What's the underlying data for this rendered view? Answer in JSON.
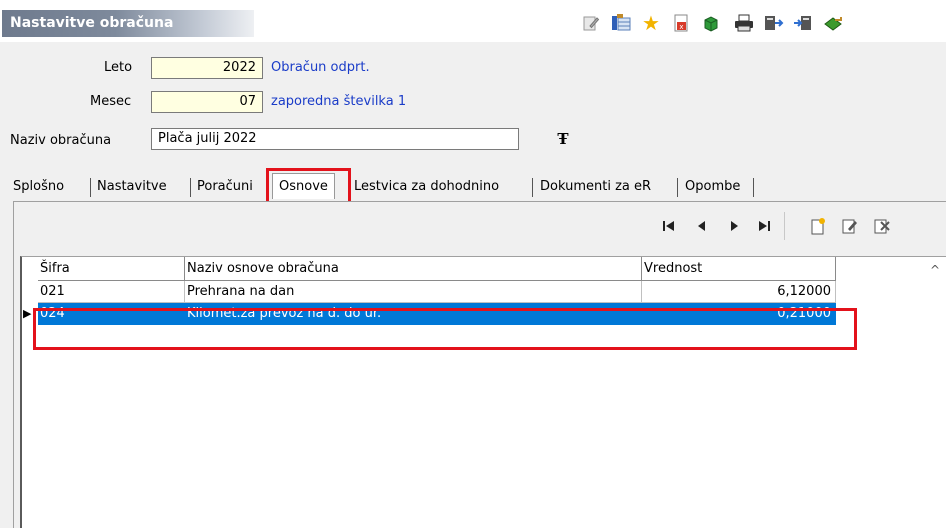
{
  "window": {
    "title": "Nastavitve obračuna"
  },
  "toolbar_icons": [
    "edit-icon",
    "table-icon",
    "star-icon",
    "pdf-icon",
    "cube-icon",
    "printer-icon",
    "export-icon",
    "import-icon",
    "exit-icon"
  ],
  "form": {
    "leto_label": "Leto",
    "leto_value": "2022",
    "leto_status": "Obračun odprt.",
    "mesec_label": "Mesec",
    "mesec_value": "07",
    "mesec_status": "zaporedna številka 1",
    "naziv_label": "Naziv obračuna",
    "naziv_value": "Plača julij 2022"
  },
  "tabs": [
    {
      "label": "Splošno"
    },
    {
      "label": "Nastavitve"
    },
    {
      "label": "Poračuni"
    },
    {
      "label": "Osnove"
    },
    {
      "label": "Lestvica za dohodnino"
    },
    {
      "label": "Dokumenti za eR"
    },
    {
      "label": "Opombe"
    }
  ],
  "active_tab": "Osnove",
  "grid": {
    "columns": [
      "Šifra",
      "Naziv osnove obračuna",
      "Vrednost"
    ],
    "rows": [
      {
        "sifra": "021",
        "naziv": "Prehrana na dan",
        "vrednost": "6,12000"
      },
      {
        "sifra": "024",
        "naziv": "Kilomet.za prevoz na d. do ur.",
        "vrednost": "0,21000"
      }
    ],
    "selected_row": 1
  },
  "colors": {
    "highlight": "#e3121b",
    "selection": "#0078d7",
    "link_text": "#1a3cc8",
    "input_yellow": "#ffffe1"
  }
}
